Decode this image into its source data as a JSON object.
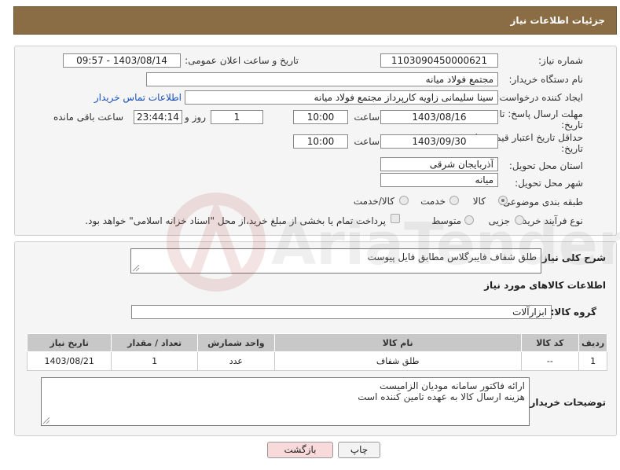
{
  "header": {
    "title": "جزئیات اطلاعات نیاز"
  },
  "form": {
    "need_number_label": "شماره نیاز:",
    "need_number": "1103090450000621",
    "announce_label": "تاریخ و ساعت اعلان عمومی:",
    "announce_value": "1403/08/14 - 09:57",
    "buyer_org_label": "نام دستگاه خریدار:",
    "buyer_org": "مجتمع فولاد میانه",
    "creator_label": "ایجاد کننده درخواست:",
    "creator": "سینا سلیمانی زاویه کارپرداز مجتمع فولاد میانه",
    "contact_link": "اطلاعات تماس خریدار",
    "deadline_label_1": "مهلت ارسال پاسخ: تا",
    "deadline_label_2": "تاریخ:",
    "deadline_date": "1403/08/16",
    "time_label": "ساعت",
    "deadline_time": "10:00",
    "days_value": "1",
    "days_label": "روز و",
    "remaining_time": "23:44:14",
    "remaining_label": "ساعت باقی مانده",
    "validity_label_1": "حداقل تاریخ اعتبار قیمت: تا",
    "validity_label_2": "تاریخ:",
    "validity_date": "1403/09/30",
    "validity_time": "10:00",
    "province_label": "استان محل تحویل:",
    "province": "آذربایجان شرقی",
    "city_label": "شهر محل تحویل:",
    "city": "میانه",
    "category_label": "طبقه بندی موضوعی:",
    "category_options": [
      "کالا",
      "خدمت",
      "کالا/خدمت"
    ],
    "process_label": "نوع فرآیند خرید :",
    "process_options": [
      "جزیی",
      "متوسط"
    ],
    "payment_note": "پرداخت تمام یا بخشی از مبلغ خرید،از محل \"اسناد خزانه اسلامی\" خواهد بود."
  },
  "details": {
    "description_label": "شرح کلی نیاز:",
    "description": "طلق شفاف فایبرگلاس مطابق فایل پیوست",
    "goods_info_title": "اطلاعات کالاهای مورد نیاز",
    "goods_group_label": "گروه کالا:",
    "goods_group": "ابزارآلات",
    "table_headers": [
      "ردیف",
      "کد کالا",
      "نام کالا",
      "واحد شمارش",
      "تعداد / مقدار",
      "تاریخ نیاز"
    ],
    "rows": [
      [
        "1",
        "--",
        "طلق شفاف",
        "عدد",
        "1",
        "1403/08/21"
      ]
    ],
    "buyer_notes_label": "توضیحات خریدار:",
    "buyer_notes_line1": "ارائه فاکتور سامانه مودیان الزامیست",
    "buyer_notes_line2": "هزینه ارسال کالا به عهده تامین کننده است"
  },
  "buttons": {
    "print": "چاپ",
    "back": "بازگشت"
  },
  "watermark": {
    "text": "AriaTender.net"
  },
  "colors": {
    "header_bg": "#8b6d45",
    "link": "#1a4fb5",
    "back_button_bg": "#f9dada",
    "table_header_bg": "#c8c8c8"
  }
}
